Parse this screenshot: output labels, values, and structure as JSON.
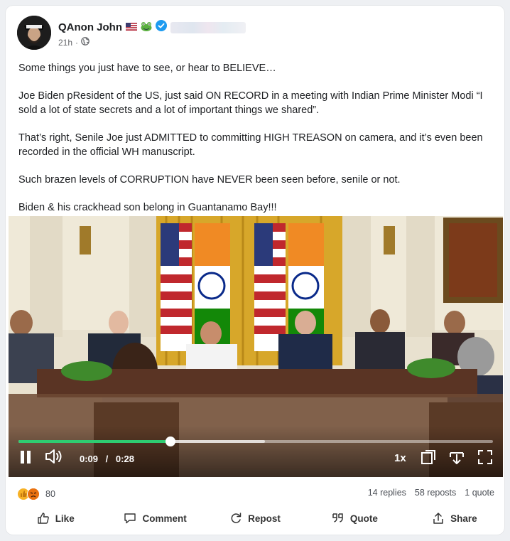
{
  "author": {
    "name": "QAnon John",
    "badges": [
      "us-flag",
      "frog"
    ],
    "verified": true,
    "timestamp": "21h",
    "visibility_icon": "globe-icon"
  },
  "post": {
    "paragraphs": [
      "Some things you just have to see, or hear to BELIEVE…",
      "Joe Biden pResident of the US, just said ON RECORD in a meeting with Indian Prime Minister Modi “I sold a lot of state secrets and a lot of important things we shared”.",
      "That’s right, Senile Joe just ADMITTED to committing HIGH TREASON on camera, and it’s even been recorded in the official WH manuscript.",
      "Such brazen levels of CORRUPTION have NEVER been seen before, senile or not.",
      "Biden & his crackhead son belong in Guantanamo Bay!!!"
    ]
  },
  "video": {
    "current_time": "0:09",
    "separator": "/",
    "duration": "0:28",
    "progress": 0.32,
    "buffered": 0.52,
    "speed": "1x",
    "accent": "#2ecc71"
  },
  "stats": {
    "reactions": [
      "like",
      "angry"
    ],
    "reaction_count": "80",
    "replies": "14 replies",
    "reposts": "58 reposts",
    "quotes": "1 quote"
  },
  "actions": {
    "like": "Like",
    "comment": "Comment",
    "repost": "Repost",
    "quote": "Quote",
    "share": "Share"
  }
}
